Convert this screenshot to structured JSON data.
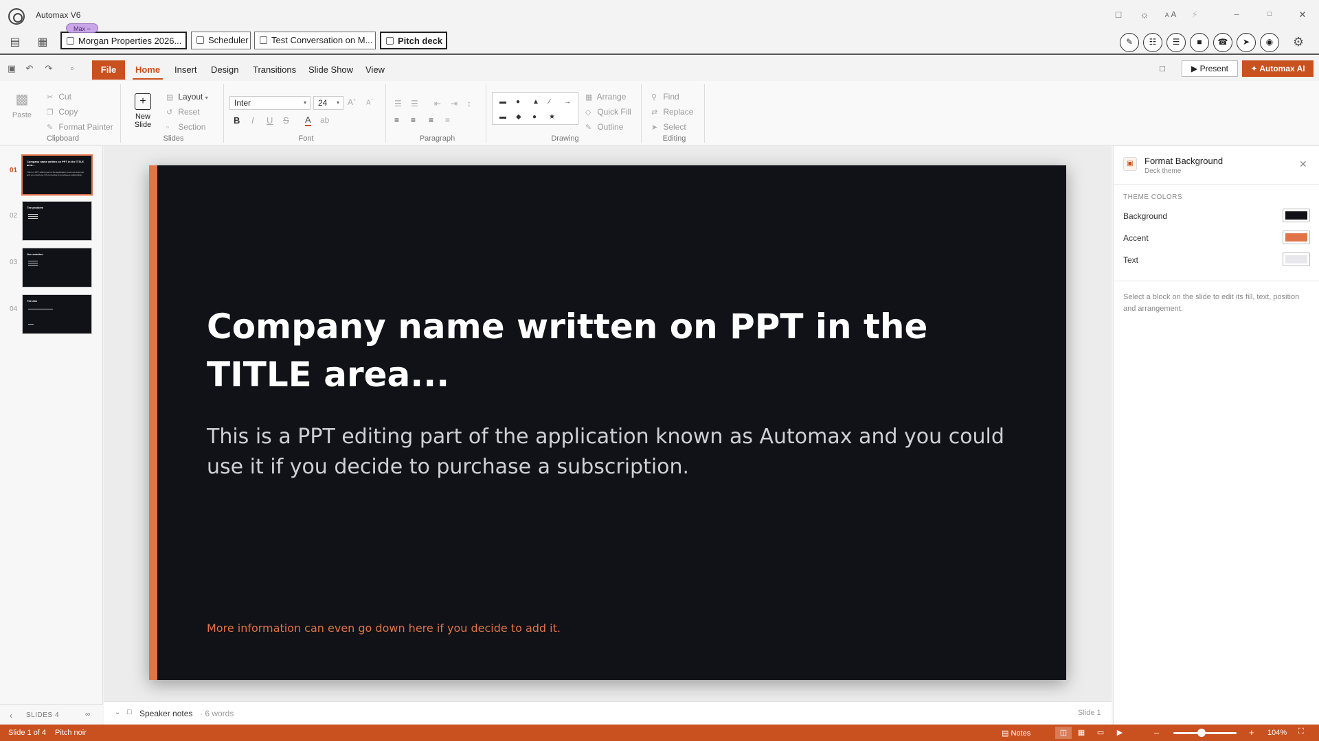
{
  "app": {
    "title": "Automax V6"
  },
  "tabs": [
    {
      "label": "Morgan Properties 2026..."
    },
    {
      "label": "Scheduler"
    },
    {
      "label": "Test Conversation on M..."
    },
    {
      "label": "Pitch deck"
    }
  ],
  "badge": {
    "max": "Max  −"
  },
  "ribbon": {
    "file": "File",
    "tabs": [
      "Home",
      "Insert",
      "Design",
      "Transitions",
      "Slide Show",
      "View"
    ],
    "present": "Present",
    "automax_ai": "Automax AI",
    "clipboard": {
      "label": "Clipboard",
      "paste": "Paste",
      "cut": "Cut",
      "copy": "Copy",
      "format_painter": "Format Painter"
    },
    "slides": {
      "label": "Slides",
      "new_slide_1": "New",
      "new_slide_2": "Slide",
      "layout": "Layout",
      "reset": "Reset",
      "section": "Section"
    },
    "font": {
      "label": "Font",
      "family": "Inter",
      "size": "24"
    },
    "paragraph": {
      "label": "Paragraph"
    },
    "drawing": {
      "label": "Drawing",
      "arrange": "Arrange",
      "quick_fill": "Quick Fill",
      "outline": "Outline"
    },
    "editing": {
      "label": "Editing",
      "find": "Find",
      "replace": "Replace",
      "select": "Select"
    }
  },
  "thumbnails": [
    {
      "num": "01",
      "title": "Company name written on PPT in the TITLE area...",
      "body": "This is a PPT editing part of the application known as Automax and you could use it if you decide to purchase a subscription."
    },
    {
      "num": "02",
      "title": "The problem",
      "body": ""
    },
    {
      "num": "03",
      "title": "Our solution",
      "body": ""
    },
    {
      "num": "04",
      "title": "The ask",
      "body": ""
    }
  ],
  "slides_footer": {
    "label": "SLIDES",
    "count": "4"
  },
  "slide": {
    "title": "Company name written on PPT in the TITLE area...",
    "subtitle": "This is a PPT editing part of the application known as Automax and you could use it if you decide to purchase a subscription.",
    "footer": "More information can even go down here if you decide to add it."
  },
  "notes": {
    "label": "Speaker notes",
    "words": "· 6 words",
    "slide_ref": "Slide 1"
  },
  "format_panel": {
    "title": "Format Background",
    "subtitle": "Deck theme",
    "section": "THEME COLORS",
    "colors": [
      {
        "label": "Background",
        "hex": "#111217"
      },
      {
        "label": "Accent",
        "hex": "#e07448"
      },
      {
        "label": "Text",
        "hex": "#e8e8ec"
      }
    ],
    "hint": "Select a block on the slide to edit its fill, text, position and arrangement."
  },
  "status": {
    "slide_of": "Slide 1 of 4",
    "theme": "Pitch noir",
    "notes": "Notes",
    "zoom": "104%",
    "zoom_level": 0.45
  },
  "colors": {
    "accent": "#c9501f",
    "slide_bg": "#111217",
    "slide_accent": "#e07448"
  },
  "icons": {
    "camera": "camera-icon",
    "sun": "sun-icon",
    "text_size": "text-size-icon",
    "bolt": "bolt-icon",
    "chat": "chat-icon",
    "grid": "grid-icon",
    "settings": "gear-icon"
  }
}
